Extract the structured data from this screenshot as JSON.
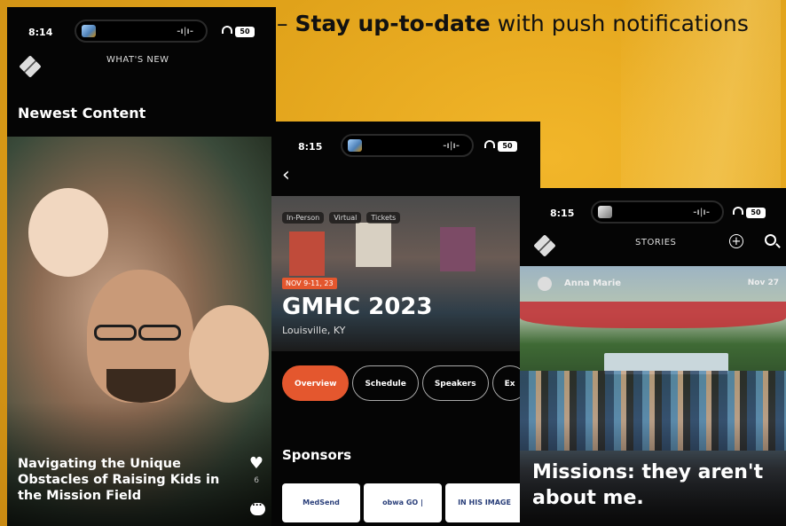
{
  "headline": {
    "bold": "Stay up-to-date",
    "rest": "with push notifications"
  },
  "phone1": {
    "time": "8:14",
    "battery": "50",
    "nav_title": "WHAT'S NEW",
    "section_title": "Newest Content",
    "article_title": "Navigating the Unique Obstacles of Raising Kids in the Mission Field",
    "like_count": "6"
  },
  "phone2": {
    "time": "8:15",
    "battery": "50",
    "chips": [
      "In-Person",
      "Virtual",
      "Tickets"
    ],
    "date_badge": "NOV 9-11, 23",
    "event_title": "GMHC 2023",
    "event_location": "Louisville, KY",
    "tabs": [
      "Overview",
      "Schedule",
      "Speakers",
      "Ex"
    ],
    "active_tab": "Overview",
    "sponsors_title": "Sponsors",
    "sponsors": [
      "MedSend",
      "obwa GO | Healthcare",
      "IN HIS IMAGE"
    ]
  },
  "phone3": {
    "time": "8:15",
    "battery": "50",
    "nav_title": "STORIES",
    "author": "Anna Marie",
    "date": "Nov 27",
    "story_title": "Missions: they aren't about me."
  },
  "colors": {
    "background": "#e0a21a",
    "accent": "#e4572e",
    "phone": "#050505"
  }
}
